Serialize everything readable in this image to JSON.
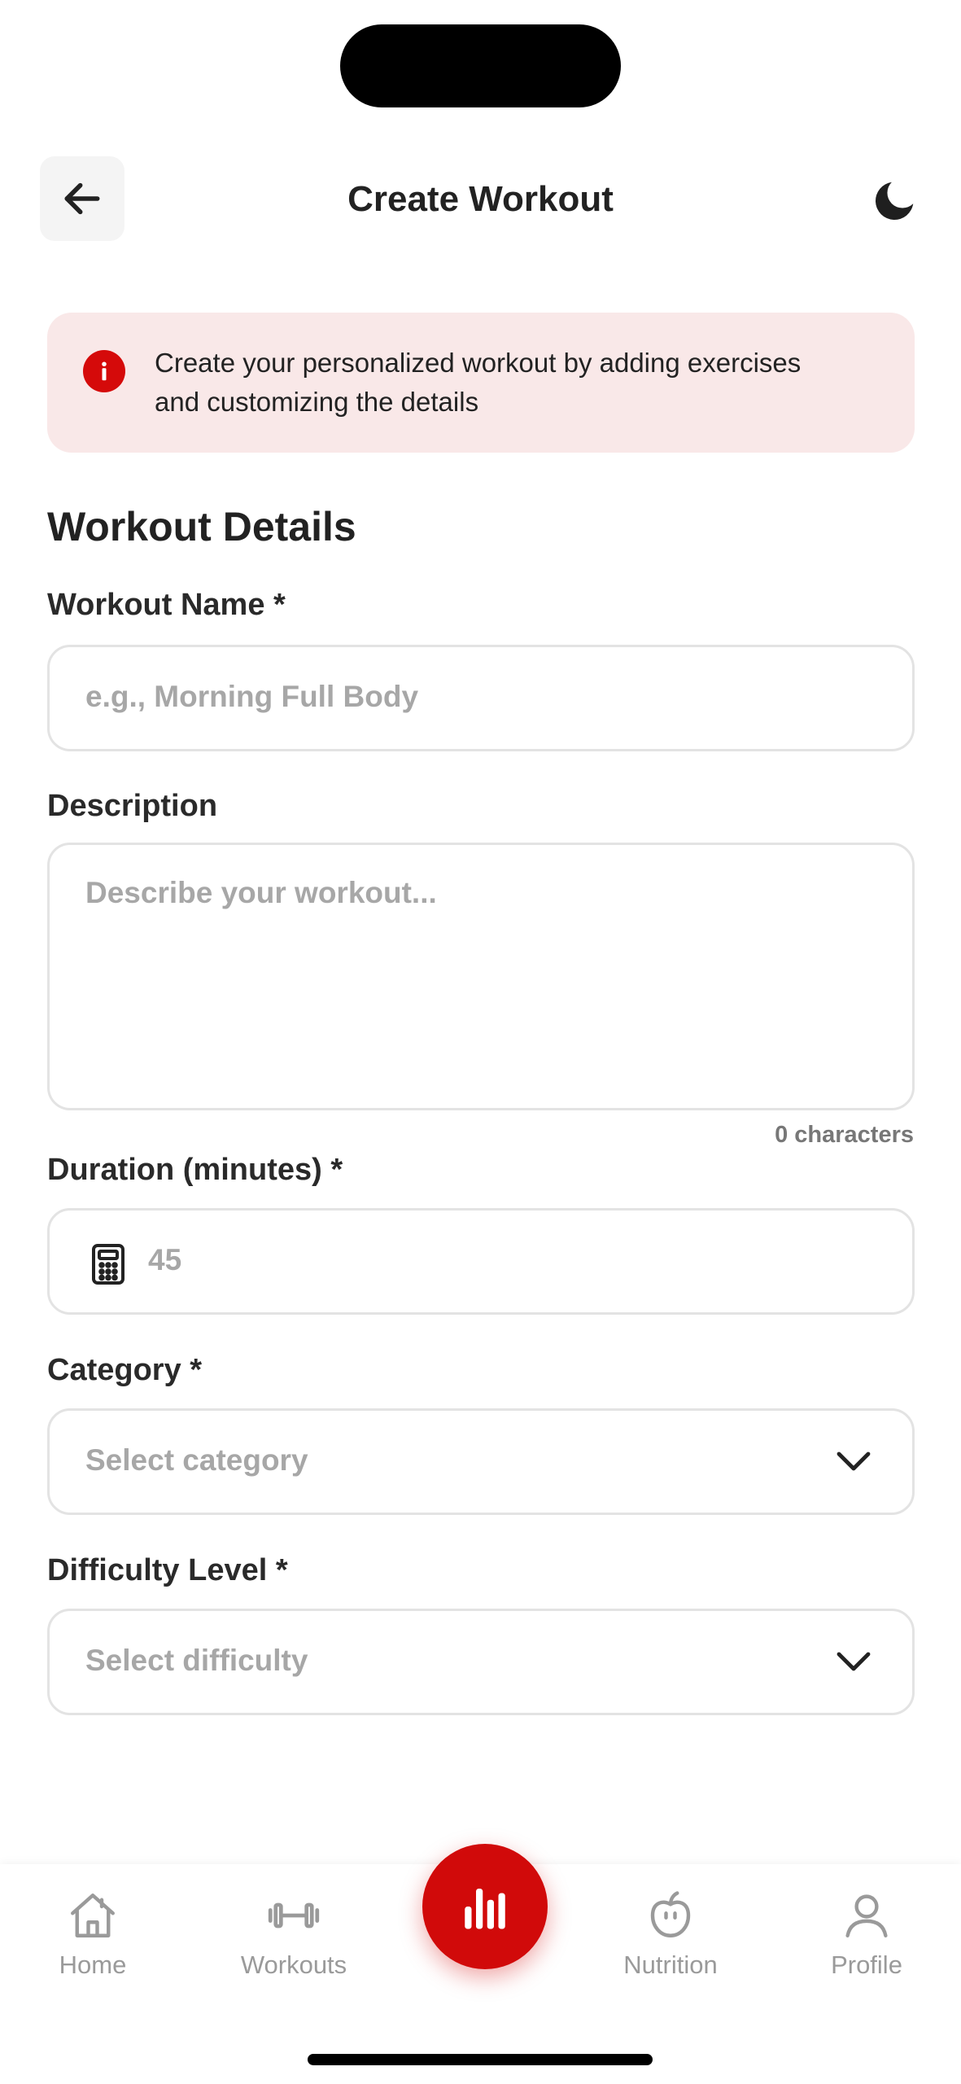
{
  "header": {
    "title": "Create Workout",
    "back_icon": "arrow-left-icon",
    "theme_icon": "moon-icon"
  },
  "info_banner": {
    "icon": "info-icon",
    "text_line1": "Create your personalized workout by adding exercises",
    "text_line2": "and customizing the details",
    "background_color": "#f9e8e8",
    "icon_color": "#d50a0a"
  },
  "section": {
    "heading": "Workout Details"
  },
  "form": {
    "workout_name": {
      "label": "Workout Name *",
      "placeholder": "e.g., Morning Full Body",
      "value": ""
    },
    "description": {
      "label": "Description",
      "placeholder": "Describe your workout...",
      "value": "",
      "char_count": "0 characters"
    },
    "duration": {
      "label": "Duration (minutes) *",
      "placeholder": "45",
      "icon": "calculator-icon",
      "value": ""
    },
    "category": {
      "label": "Category *",
      "placeholder": "Select category",
      "icon": "chevron-down-icon"
    },
    "difficulty": {
      "label": "Difficulty Level *",
      "placeholder": "Select difficulty",
      "icon": "chevron-down-icon"
    }
  },
  "bottom_nav": {
    "items": [
      {
        "label": "Home",
        "icon": "home-icon"
      },
      {
        "label": "Workouts",
        "icon": "dumbbell-icon"
      },
      {
        "label": "",
        "icon": "bar-chart-icon"
      },
      {
        "label": "Nutrition",
        "icon": "apple-icon"
      },
      {
        "label": "Profile",
        "icon": "person-icon"
      }
    ],
    "accent_color": "#d10a0a",
    "inactive_color": "#9a9a9a"
  }
}
